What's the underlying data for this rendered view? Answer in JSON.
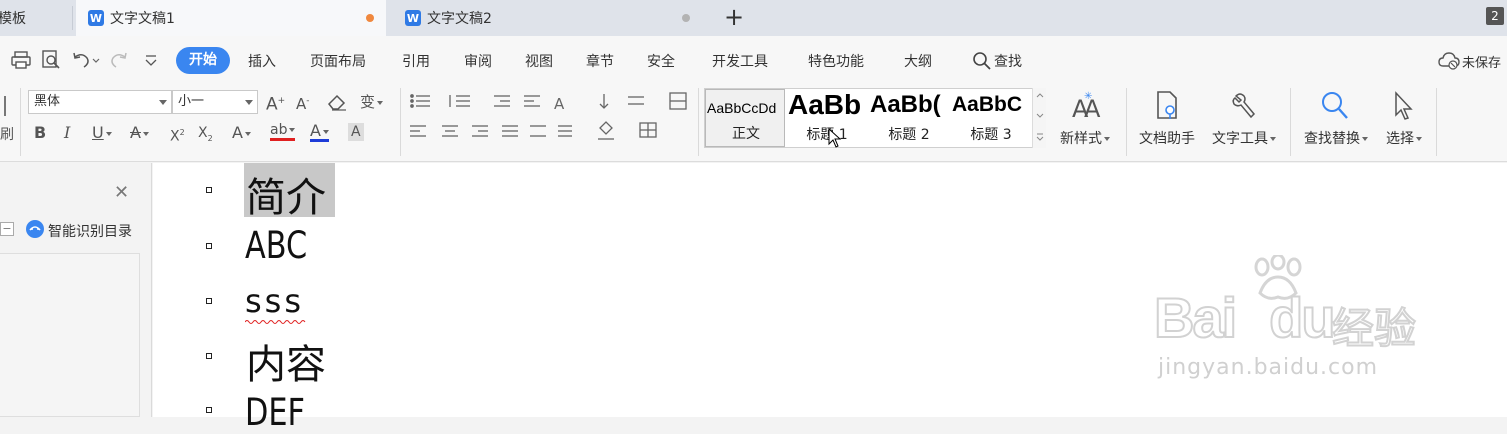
{
  "tabs": [
    {
      "label": "模板",
      "active": false
    },
    {
      "label": "文字文稿1",
      "active": true,
      "dot_color": "#f0883e"
    },
    {
      "label": "文字文稿2",
      "active": false,
      "dot_color": "#b3b3b3"
    }
  ],
  "window_count": "2",
  "menu": {
    "start": "开始",
    "items": [
      "插入",
      "页面布局",
      "引用",
      "审阅",
      "视图",
      "章节",
      "安全",
      "开发工具",
      "特色功能",
      "大纲"
    ],
    "search": "查找",
    "unsaved": "未保存"
  },
  "font": {
    "name": "黑体",
    "size": "小一"
  },
  "styles": [
    {
      "sample": "AaBbCcDd",
      "name": "正文"
    },
    {
      "sample": "AaBb",
      "name": "标题 1"
    },
    {
      "sample": "AaBb(",
      "name": "标题 2"
    },
    {
      "sample": "AaBbC",
      "name": "标题 3"
    }
  ],
  "ribbon_buttons": {
    "new_style": "新样式",
    "doc_helper": "文档助手",
    "text_tools": "文字工具",
    "find_replace": "查找替换",
    "select": "选择"
  },
  "left_panel": {
    "smart_toc": "智能识别目录"
  },
  "document": {
    "lines": [
      "简介",
      "ABC",
      "sss",
      "内容",
      "DEF"
    ]
  },
  "watermark": {
    "brand": "Bai",
    "brand2": "du",
    "cn": "经验",
    "url": "jingyan.baidu.com"
  },
  "colors": {
    "accent": "#3a86f0",
    "text_underline_red": "#e02020",
    "font_color_blue": "#1e3cd8"
  }
}
